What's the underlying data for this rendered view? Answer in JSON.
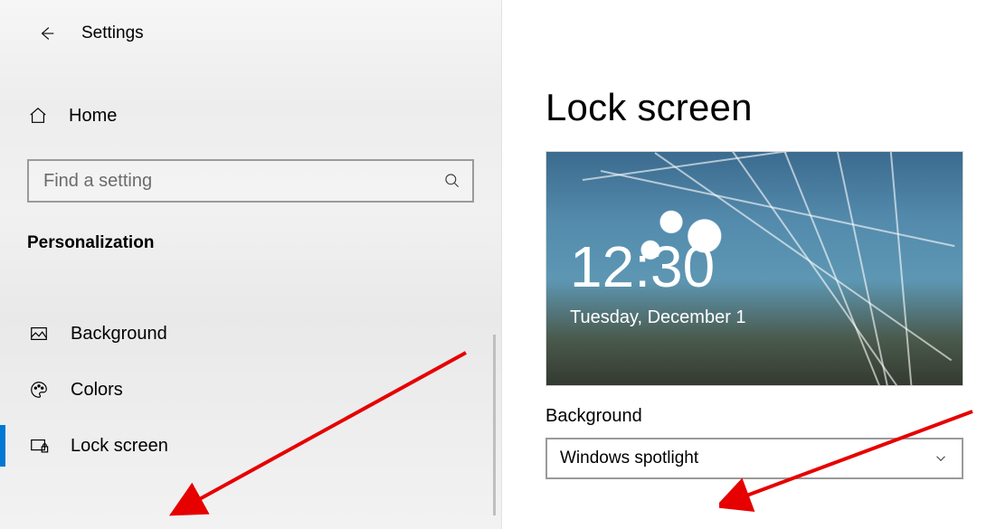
{
  "header": {
    "app_title": "Settings"
  },
  "sidebar": {
    "home_label": "Home",
    "search_placeholder": "Find a setting",
    "category": "Personalization",
    "items": [
      {
        "label": "Background"
      },
      {
        "label": "Colors"
      },
      {
        "label": "Lock screen"
      }
    ]
  },
  "main": {
    "page_title": "Lock screen",
    "preview_time": "12:30",
    "preview_date": "Tuesday, December 1",
    "background_section_label": "Background",
    "background_dropdown_value": "Windows spotlight"
  }
}
